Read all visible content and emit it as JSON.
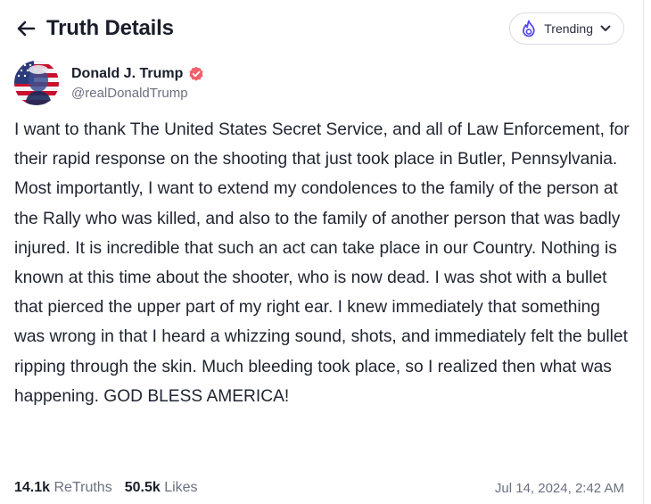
{
  "header": {
    "title": "Truth Details",
    "back_icon": "arrow-left-icon",
    "trending_label": "Trending"
  },
  "author": {
    "name": "Donald J. Trump",
    "handle": "@realDonaldTrump",
    "verified_color": "#f0616d"
  },
  "post": {
    "text": "I want to thank The United States Secret Service, and all of Law Enforcement, for their rapid response on the shooting that just took place in Butler, Pennsylvania. Most importantly, I want to extend my condolences to the family of the person at the Rally who was killed, and also to the family of another person that was badly injured. It is incredible that such an act can take place in our Country. Nothing is known at this time about the shooter, who is now dead. I was shot with a bullet that pierced the upper part of my right ear. I knew immediately that something was wrong in that I heard a whizzing sound, shots, and immediately felt the bullet ripping through the skin. Much bleeding took place, so I realized then what was happening. GOD BLESS AMERICA!"
  },
  "stats": {
    "retruths_count": "14.1k",
    "retruths_label": "ReTruths",
    "likes_count": "50.5k",
    "likes_label": "Likes",
    "timestamp": "Jul 14, 2024, 2:42 AM"
  },
  "colors": {
    "accent": "#5448ee",
    "text": "#1f2430",
    "muted": "#6b7080"
  }
}
